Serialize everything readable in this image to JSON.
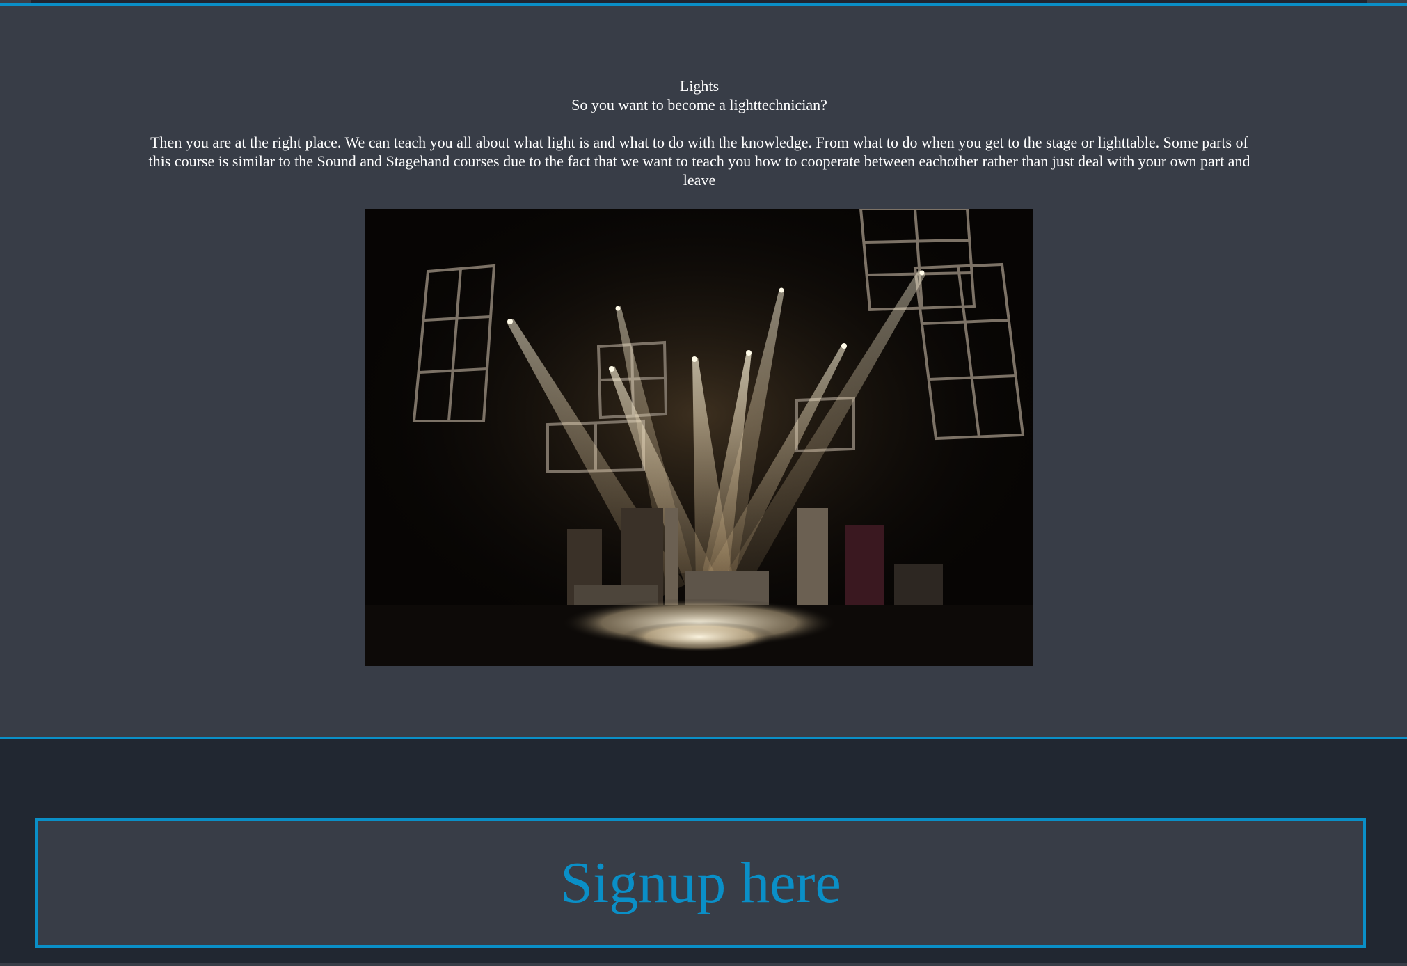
{
  "section": {
    "title": "Lights",
    "subtitle": "So you want to become a lighttechnician?",
    "body": "Then you are at the right place. We can teach you all about what light is and what to do with the knowledge. From what to do when you get to the stage or lighttable. Some parts of this course is similar to the Sound and Stagehand courses due to the fact that we want to teach you how to cooperate between eachother rather than just deal with your own part and leave"
  },
  "hero_image": {
    "alt": "Stage lights shining over a theatre set"
  },
  "signup": {
    "label": "Signup here"
  },
  "colors": {
    "accent": "#0a8fc7",
    "content_bg": "#383d47",
    "page_bg": "#212731",
    "text": "#ffffff"
  }
}
